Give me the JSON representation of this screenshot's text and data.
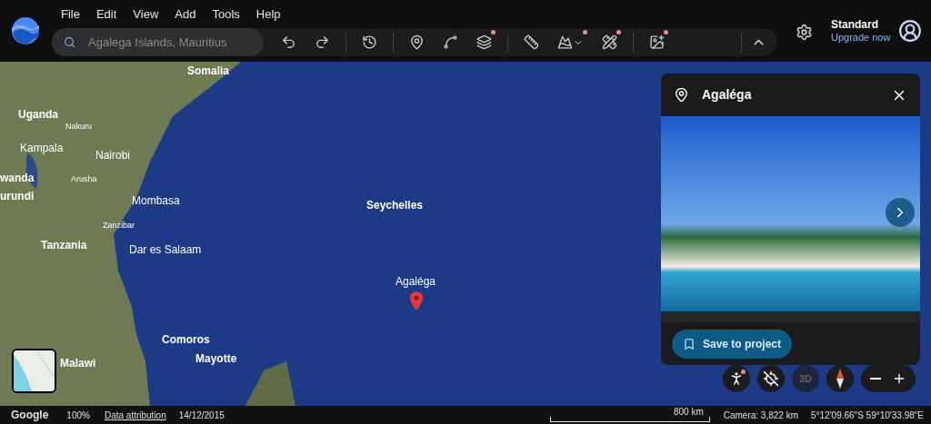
{
  "menu": [
    "File",
    "Edit",
    "View",
    "Add",
    "Tools",
    "Help"
  ],
  "search": {
    "placeholder": "Agalega Islands, Mauritius"
  },
  "toolbar": [
    {
      "kind": "undo",
      "badge": false
    },
    {
      "kind": "redo",
      "badge": false
    },
    {
      "kind": "separator"
    },
    {
      "kind": "history",
      "badge": false
    },
    {
      "kind": "separator"
    },
    {
      "kind": "placemark",
      "badge": false
    },
    {
      "kind": "path",
      "badge": false
    },
    {
      "kind": "layers",
      "badge": true
    },
    {
      "kind": "separator"
    },
    {
      "kind": "ruler",
      "badge": false
    },
    {
      "kind": "terrain",
      "badge": true
    },
    {
      "kind": "tools",
      "badge": true
    },
    {
      "kind": "separator"
    },
    {
      "kind": "add-photo",
      "badge": true
    }
  ],
  "account": {
    "plan": "Standard",
    "upgrade": "Upgrade now"
  },
  "map_labels": [
    {
      "text": "Somalia",
      "kind": "country"
    },
    {
      "text": "Uganda",
      "kind": "country"
    },
    {
      "text": "Nakuru",
      "kind": "town"
    },
    {
      "text": "Kampala",
      "kind": "city"
    },
    {
      "text": "Nairobi",
      "kind": "city"
    },
    {
      "text": "wanda",
      "kind": "country"
    },
    {
      "text": "Arusha",
      "kind": "town"
    },
    {
      "text": "urundi",
      "kind": "country"
    },
    {
      "text": "Mombasa",
      "kind": "city"
    },
    {
      "text": "Seychelles",
      "kind": "country"
    },
    {
      "text": "Zanzibar",
      "kind": "town"
    },
    {
      "text": "Tanzania",
      "kind": "country"
    },
    {
      "text": "Dar es Salaam",
      "kind": "city"
    },
    {
      "text": "Agaléga",
      "kind": "place"
    },
    {
      "text": "Comoros",
      "kind": "country"
    },
    {
      "text": "Malawi",
      "kind": "country"
    },
    {
      "text": "Mayotte",
      "kind": "country"
    }
  ],
  "place_panel": {
    "title": "Agaléga",
    "button": "Save to project"
  },
  "map_controls": {
    "pegman_badge": true,
    "three_d": {
      "label": "3D",
      "disabled": true
    }
  },
  "status_bar": {
    "brand": "Google",
    "zoom": "100%",
    "attribution": "Data attribution",
    "date": "14/12/2015",
    "scale": "800 km",
    "camera": "Camera: 3,822 km",
    "coordinates": "5°12'09.66\"S 59°10'33.98\"E"
  }
}
